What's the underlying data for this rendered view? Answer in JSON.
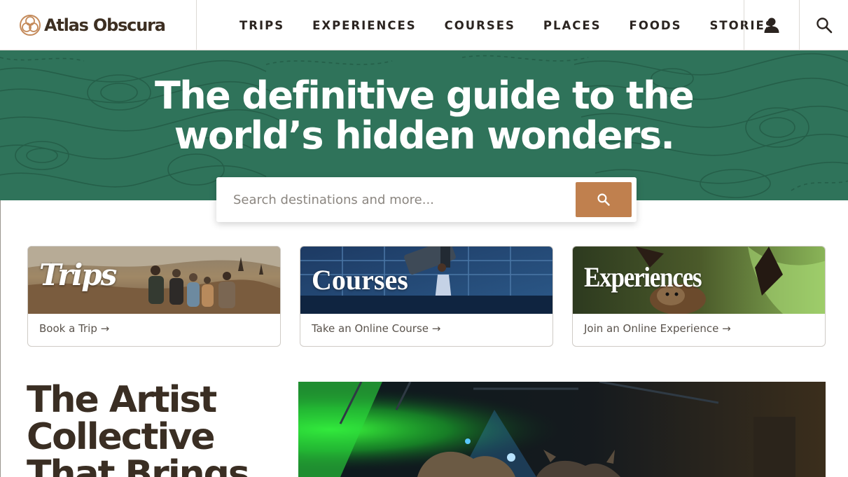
{
  "brand": {
    "name": "Atlas Obscura"
  },
  "nav": {
    "links": [
      "TRIPS",
      "EXPERIENCES",
      "COURSES",
      "PLACES",
      "FOODS",
      "STORIES"
    ],
    "account_icon": "user-icon",
    "search_icon": "search-icon"
  },
  "hero": {
    "title_line1": "The definitive guide to the",
    "title_line2": "world’s hidden wonders.",
    "background_color": "#2f735a"
  },
  "search": {
    "placeholder": "Search destinations and more...",
    "value": "",
    "button_icon": "search-icon",
    "button_color": "#c0804e"
  },
  "cards": [
    {
      "word": "Trips",
      "link": "Book a Trip →"
    },
    {
      "word": "Courses",
      "link": "Take an Online Course →"
    },
    {
      "word": "Experiences",
      "link": "Join an Online Experience →"
    }
  ],
  "feature": {
    "title": "The Artist Collective That Brings"
  },
  "colors": {
    "brand_brown": "#3a2e23",
    "accent": "#c0804e",
    "hero_green": "#2f735a"
  }
}
